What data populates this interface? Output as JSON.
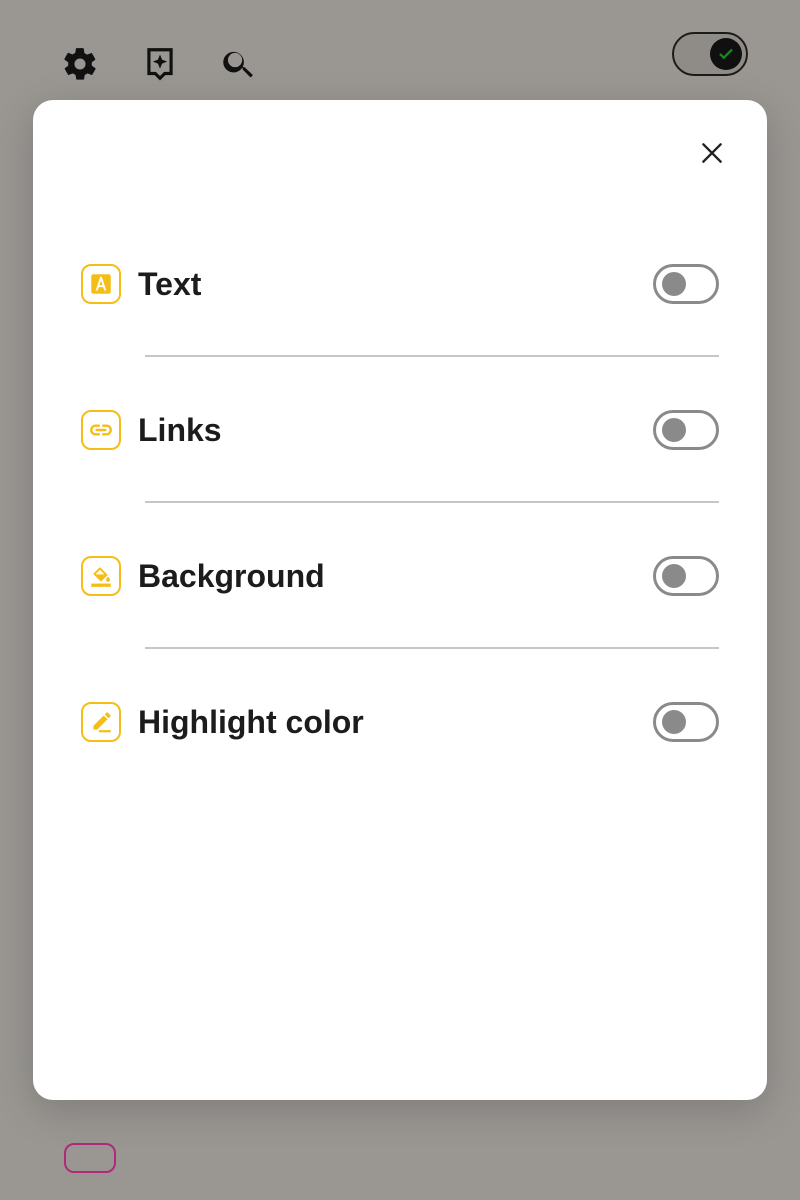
{
  "toolbar": {
    "icons": [
      "gear-icon",
      "add-bookmark-icon",
      "search-icon"
    ]
  },
  "theme_toggle": {
    "state": "on",
    "icon": "check-icon"
  },
  "modal": {
    "close_icon": "close-icon",
    "settings": [
      {
        "label": "Text",
        "icon": "text-color-icon",
        "enabled": false
      },
      {
        "label": "Links",
        "icon": "link-icon",
        "enabled": false
      },
      {
        "label": "Background",
        "icon": "paint-bucket-icon",
        "enabled": false
      },
      {
        "label": "Highlight color",
        "icon": "highlighter-icon",
        "enabled": false
      }
    ]
  },
  "colors": {
    "accent": "#f6bd16",
    "backdrop": "#9a9793",
    "text": "#1c1c1c",
    "switch_off": "#8a8a8a"
  }
}
